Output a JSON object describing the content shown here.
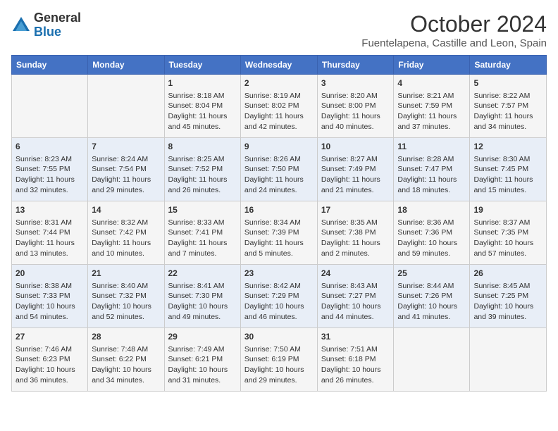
{
  "header": {
    "logo_general": "General",
    "logo_blue": "Blue",
    "month_title": "October 2024",
    "location": "Fuentelapena, Castille and Leon, Spain"
  },
  "days_of_week": [
    "Sunday",
    "Monday",
    "Tuesday",
    "Wednesday",
    "Thursday",
    "Friday",
    "Saturday"
  ],
  "weeks": [
    [
      {
        "day": "",
        "info": ""
      },
      {
        "day": "",
        "info": ""
      },
      {
        "day": "1",
        "info": "Sunrise: 8:18 AM\nSunset: 8:04 PM\nDaylight: 11 hours and 45 minutes."
      },
      {
        "day": "2",
        "info": "Sunrise: 8:19 AM\nSunset: 8:02 PM\nDaylight: 11 hours and 42 minutes."
      },
      {
        "day": "3",
        "info": "Sunrise: 8:20 AM\nSunset: 8:00 PM\nDaylight: 11 hours and 40 minutes."
      },
      {
        "day": "4",
        "info": "Sunrise: 8:21 AM\nSunset: 7:59 PM\nDaylight: 11 hours and 37 minutes."
      },
      {
        "day": "5",
        "info": "Sunrise: 8:22 AM\nSunset: 7:57 PM\nDaylight: 11 hours and 34 minutes."
      }
    ],
    [
      {
        "day": "6",
        "info": "Sunrise: 8:23 AM\nSunset: 7:55 PM\nDaylight: 11 hours and 32 minutes."
      },
      {
        "day": "7",
        "info": "Sunrise: 8:24 AM\nSunset: 7:54 PM\nDaylight: 11 hours and 29 minutes."
      },
      {
        "day": "8",
        "info": "Sunrise: 8:25 AM\nSunset: 7:52 PM\nDaylight: 11 hours and 26 minutes."
      },
      {
        "day": "9",
        "info": "Sunrise: 8:26 AM\nSunset: 7:50 PM\nDaylight: 11 hours and 24 minutes."
      },
      {
        "day": "10",
        "info": "Sunrise: 8:27 AM\nSunset: 7:49 PM\nDaylight: 11 hours and 21 minutes."
      },
      {
        "day": "11",
        "info": "Sunrise: 8:28 AM\nSunset: 7:47 PM\nDaylight: 11 hours and 18 minutes."
      },
      {
        "day": "12",
        "info": "Sunrise: 8:30 AM\nSunset: 7:45 PM\nDaylight: 11 hours and 15 minutes."
      }
    ],
    [
      {
        "day": "13",
        "info": "Sunrise: 8:31 AM\nSunset: 7:44 PM\nDaylight: 11 hours and 13 minutes."
      },
      {
        "day": "14",
        "info": "Sunrise: 8:32 AM\nSunset: 7:42 PM\nDaylight: 11 hours and 10 minutes."
      },
      {
        "day": "15",
        "info": "Sunrise: 8:33 AM\nSunset: 7:41 PM\nDaylight: 11 hours and 7 minutes."
      },
      {
        "day": "16",
        "info": "Sunrise: 8:34 AM\nSunset: 7:39 PM\nDaylight: 11 hours and 5 minutes."
      },
      {
        "day": "17",
        "info": "Sunrise: 8:35 AM\nSunset: 7:38 PM\nDaylight: 11 hours and 2 minutes."
      },
      {
        "day": "18",
        "info": "Sunrise: 8:36 AM\nSunset: 7:36 PM\nDaylight: 10 hours and 59 minutes."
      },
      {
        "day": "19",
        "info": "Sunrise: 8:37 AM\nSunset: 7:35 PM\nDaylight: 10 hours and 57 minutes."
      }
    ],
    [
      {
        "day": "20",
        "info": "Sunrise: 8:38 AM\nSunset: 7:33 PM\nDaylight: 10 hours and 54 minutes."
      },
      {
        "day": "21",
        "info": "Sunrise: 8:40 AM\nSunset: 7:32 PM\nDaylight: 10 hours and 52 minutes."
      },
      {
        "day": "22",
        "info": "Sunrise: 8:41 AM\nSunset: 7:30 PM\nDaylight: 10 hours and 49 minutes."
      },
      {
        "day": "23",
        "info": "Sunrise: 8:42 AM\nSunset: 7:29 PM\nDaylight: 10 hours and 46 minutes."
      },
      {
        "day": "24",
        "info": "Sunrise: 8:43 AM\nSunset: 7:27 PM\nDaylight: 10 hours and 44 minutes."
      },
      {
        "day": "25",
        "info": "Sunrise: 8:44 AM\nSunset: 7:26 PM\nDaylight: 10 hours and 41 minutes."
      },
      {
        "day": "26",
        "info": "Sunrise: 8:45 AM\nSunset: 7:25 PM\nDaylight: 10 hours and 39 minutes."
      }
    ],
    [
      {
        "day": "27",
        "info": "Sunrise: 7:46 AM\nSunset: 6:23 PM\nDaylight: 10 hours and 36 minutes."
      },
      {
        "day": "28",
        "info": "Sunrise: 7:48 AM\nSunset: 6:22 PM\nDaylight: 10 hours and 34 minutes."
      },
      {
        "day": "29",
        "info": "Sunrise: 7:49 AM\nSunset: 6:21 PM\nDaylight: 10 hours and 31 minutes."
      },
      {
        "day": "30",
        "info": "Sunrise: 7:50 AM\nSunset: 6:19 PM\nDaylight: 10 hours and 29 minutes."
      },
      {
        "day": "31",
        "info": "Sunrise: 7:51 AM\nSunset: 6:18 PM\nDaylight: 10 hours and 26 minutes."
      },
      {
        "day": "",
        "info": ""
      },
      {
        "day": "",
        "info": ""
      }
    ]
  ]
}
